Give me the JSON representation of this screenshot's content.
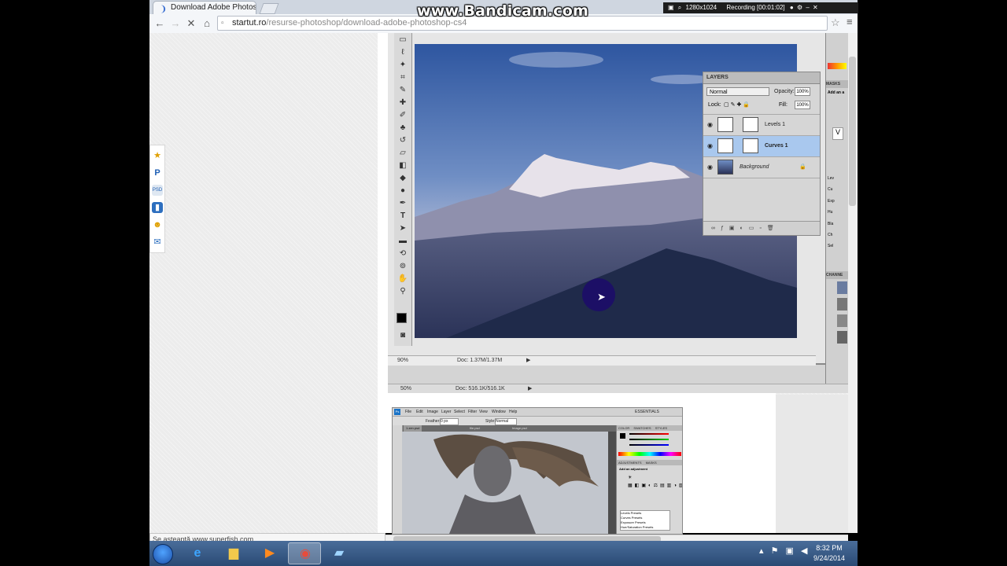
{
  "bandicam": {
    "watermark": "www.Bandicam.com",
    "resolution": "1280x1024",
    "recording": "Recording [00:01:02]"
  },
  "browser": {
    "tab_title": "Download Adobe Photosh",
    "url_host": "startut.ro",
    "url_path": "/resurse-photoshop/download-adobe-photoshop-cs4",
    "status_text": "Se așteaptă www.superfish.com..."
  },
  "photoshop_screenshot_1": {
    "zoom_inner": "90%",
    "doc_inner": "Doc: 1.37M/1.37M",
    "zoom_outer": "50%",
    "doc_outer": "Doc: 516.1K/516.1K",
    "layers_panel": {
      "title": "LAYERS",
      "blend_mode": "Normal",
      "opacity_label": "Opacity:",
      "opacity_value": "100%",
      "lock_label": "Lock:",
      "fill_label": "Fill:",
      "fill_value": "100%",
      "layers": [
        {
          "name": "Levels 1",
          "selected": false
        },
        {
          "name": "Curves 1",
          "selected": true
        },
        {
          "name": "Background",
          "selected": false,
          "locked": true
        }
      ]
    },
    "side_panels": {
      "masks": "MASKS",
      "add_an": "Add an a",
      "channels": "CHANNE",
      "adjust_items": [
        "Lev",
        "Cu",
        "Exp",
        "Hu",
        "Bla",
        "Ch",
        "Sel"
      ]
    }
  },
  "photoshop_screenshot_2": {
    "workspace": "ESSENTIALS",
    "menu": [
      "File",
      "Edit",
      "Image",
      "Layer",
      "Select",
      "Filter",
      "View",
      "Window",
      "Help"
    ],
    "opts_feather": "Feather:",
    "opts_feather_val": "0 px",
    "opts_style": "Style:",
    "opts_style_val": "Normal",
    "doc_tabs": [
      "1.zen.psd",
      "file.psd",
      "Image.psd"
    ],
    "panel_color": "COLOR",
    "panel_swatches": "SWATCHES",
    "panel_styles": "STYLES",
    "panel_adjustments": "ADJUSTMENTS",
    "panel_masks": "MASKS",
    "add_adjustment": "Add an adjustment",
    "presets": [
      "Levels Presets",
      "Curves Presets",
      "Exposure Presets",
      "Hue/Saturation Presets"
    ]
  },
  "taskbar": {
    "time": "8:32 PM",
    "date": "9/24/2014"
  }
}
